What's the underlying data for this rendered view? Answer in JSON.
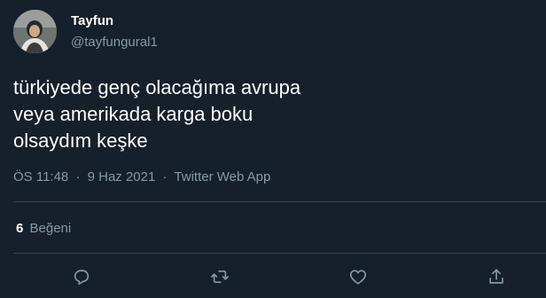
{
  "author": {
    "display_name": "Tayfun",
    "handle": "@tayfungural1"
  },
  "tweet": {
    "lines": [
      "türkiyede genç olacağıma avrupa",
      "veya amerikada karga boku",
      "olsaydım keşke"
    ]
  },
  "meta": {
    "time": "ÖS 11:48",
    "separator": "·",
    "date": "9 Haz 2021",
    "source": "Twitter Web App"
  },
  "stats": {
    "likes_count": "6",
    "likes_label": "Beğeni"
  },
  "actions": [
    {
      "icon": "reply-icon"
    },
    {
      "icon": "retweet-icon"
    },
    {
      "icon": "like-icon"
    },
    {
      "icon": "share-icon"
    }
  ],
  "colors": {
    "background": "#15202b",
    "text_primary": "#ffffff",
    "text_secondary": "#8899a6",
    "divider": "#38444d"
  }
}
